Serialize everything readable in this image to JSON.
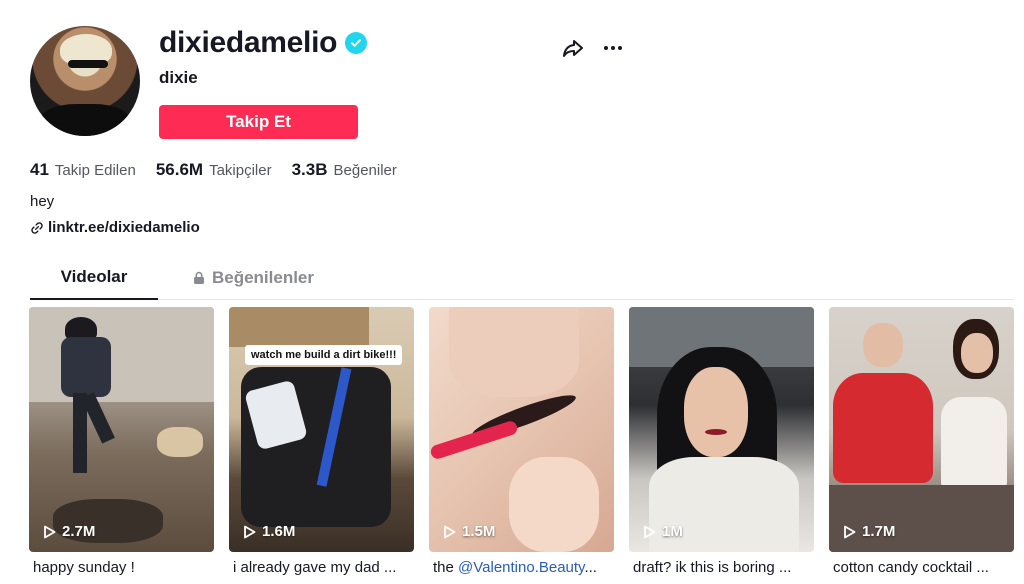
{
  "profile": {
    "username": "dixiedamelio",
    "nickname": "dixie",
    "follow_label": "Takip Et",
    "bio": "hey",
    "link": "linktr.ee/dixiedamelio",
    "verified_icon": "verified-badge-icon"
  },
  "stats": [
    {
      "value": "41",
      "label": "Takip Edilen"
    },
    {
      "value": "56.6M",
      "label": "Takipçiler"
    },
    {
      "value": "3.3B",
      "label": "Beğeniler"
    }
  ],
  "tabs": [
    {
      "label": "Videolar",
      "active": true
    },
    {
      "label": "Beğenilenler",
      "active": false,
      "icon": "lock-icon"
    }
  ],
  "videos": [
    {
      "views": "2.7M",
      "caption": "happy sunday !"
    },
    {
      "views": "1.6M",
      "caption": "i already gave my dad ...",
      "overlay": "watch me build a dirt bike!!!"
    },
    {
      "views": "1.5M",
      "caption_prefix": "the ",
      "caption_mention": "@Valentino.Beauty",
      "caption_suffix": "..."
    },
    {
      "views": "1M",
      "caption": "draft? ik this is boring ..."
    },
    {
      "views": "1.7M",
      "caption": "cotton candy cocktail ..."
    }
  ],
  "colors": {
    "accent": "#fe2c55",
    "verified": "#20d5ec",
    "text": "#161823",
    "muted": "#8a8b91",
    "mention": "#2b5db9"
  }
}
